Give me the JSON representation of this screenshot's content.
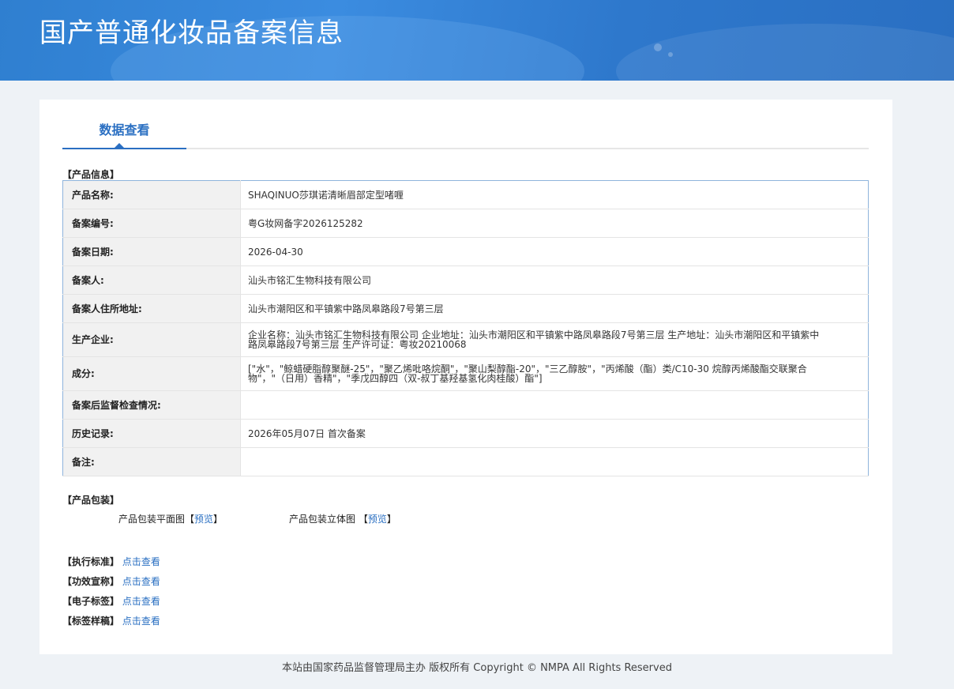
{
  "header": {
    "title": "国产普通化妆品备案信息"
  },
  "tabs": [
    {
      "label": "数据查看",
      "active": true
    }
  ],
  "product_info": {
    "section_label": "【产品信息】",
    "rows": [
      {
        "key": "产品名称:",
        "value": "SHAQINUO莎琪诺清晰眉部定型啫喱"
      },
      {
        "key": "备案编号:",
        "value": "粤G妆网备字2026125282"
      },
      {
        "key": "备案日期:",
        "value": "2026-04-30"
      },
      {
        "key": "备案人:",
        "value": "汕头市铭汇生物科技有限公司"
      },
      {
        "key": "备案人住所地址:",
        "value": "汕头市潮阳区和平镇紫中路凤皋路段7号第三层"
      },
      {
        "key": "生产企业:",
        "value": "企业名称：汕头市铭汇生物科技有限公司 企业地址：汕头市潮阳区和平镇紫中路凤皋路段7号第三层 生产地址：汕头市潮阳区和平镇紫中路凤皋路段7号第三层 生产许可证：粤妆20210068"
      },
      {
        "key": "成分:",
        "value": "[\"水\"，\"鲸蜡硬脂醇聚醚-25\"，\"聚乙烯吡咯烷酮\"，\"聚山梨醇酯-20\"，\"三乙醇胺\"，\"丙烯酸（酯）类/C10-30 烷醇丙烯酸酯交联聚合物\"，\"（日用）香精\"，\"季戊四醇四（双-叔丁基羟基氢化肉桂酸）酯\"]"
      },
      {
        "key": "备案后监督检查情况:",
        "value": ""
      },
      {
        "key": "历史记录:",
        "value": "2026年05月07日 首次备案"
      },
      {
        "key": "备注:",
        "value": ""
      }
    ]
  },
  "packaging": {
    "section_label": "【产品包装】",
    "flat_label": "产品包装平面图",
    "flat_open": "【",
    "flat_link": "预览",
    "flat_close": "】",
    "stereo_label": "产品包装立体图",
    "stereo_open": "【",
    "stereo_link": "预览",
    "stereo_close": "】"
  },
  "documents": [
    {
      "label": "【执行标准】",
      "link": "点击查看"
    },
    {
      "label": "【功效宣称】",
      "link": "点击查看"
    },
    {
      "label": "【电子标签】",
      "link": "点击查看"
    },
    {
      "label": "【标签样稿】",
      "link": "点击查看"
    }
  ],
  "footer": {
    "text": "本站由国家药品监督管理局主办 版权所有 Copyright © NMPA All Rights Reserved"
  }
}
